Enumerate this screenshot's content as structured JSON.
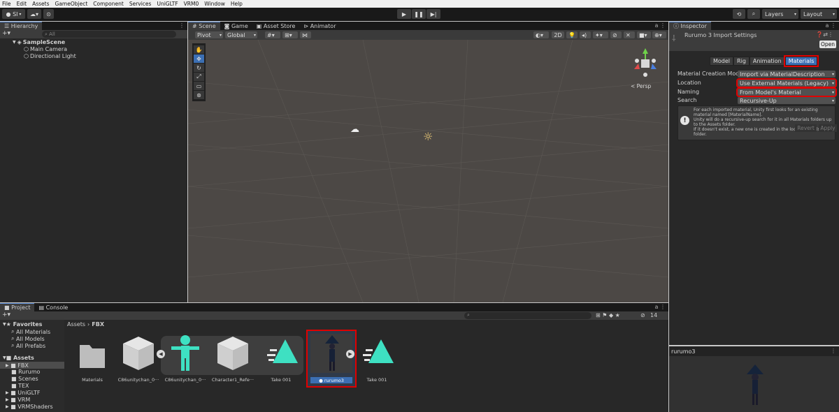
{
  "menu": [
    "File",
    "Edit",
    "Assets",
    "GameObject",
    "Component",
    "Services",
    "UniGLTF",
    "VRM0",
    "Window",
    "Help"
  ],
  "toolbar": {
    "account": "SI",
    "layers": "Layers",
    "layout": "Layout"
  },
  "hierarchy": {
    "tab": "Hierarchy",
    "search_placeholder": "All",
    "scene": "SampleScene",
    "items": [
      "Main Camera",
      "Directional Light"
    ]
  },
  "scene": {
    "tabs": [
      "Scene",
      "Game",
      "Asset Store",
      "Animator"
    ],
    "pivot": "Pivot",
    "global": "Global",
    "mode2d": "2D",
    "persp": "< Persp"
  },
  "inspector": {
    "tab": "Inspector",
    "title": "Rurumo 3 Import Settings",
    "open": "Open",
    "tabs": [
      "Model",
      "Rig",
      "Animation",
      "Materials"
    ],
    "fields": [
      {
        "label": "Material Creation Mode",
        "value": "Import via MaterialDescription"
      },
      {
        "label": "Location",
        "value": "Use External Materials (Legacy)"
      },
      {
        "label": "Naming",
        "value": "From Model's Material"
      },
      {
        "label": "Search",
        "value": "Recursive-Up"
      }
    ],
    "info": "For each imported material, Unity first looks for an existing material named [MaterialName].\nUnity will do a recursive-up search for it in all Materials folders up to the Assets folder.\nIf it doesn't exist, a new one is created in the local Materials folder.",
    "revert": "Revert",
    "apply": "Apply",
    "preview_title": "rurumo3"
  },
  "project": {
    "tabs": [
      "Project",
      "Console"
    ],
    "breadcrumb": [
      "Assets",
      "FBX"
    ],
    "count": "14",
    "favorites": "Favorites",
    "fav_items": [
      "All Materials",
      "All Models",
      "All Prefabs"
    ],
    "assets_root": "Assets",
    "tree": [
      "FBX",
      "Rurumo",
      "Scenes",
      "TEX",
      "UniGLTF",
      "VRM",
      "VRMShaders"
    ],
    "grid": [
      "Materials",
      "C86unitychan_0···",
      "C86unitychan_0···",
      "Character1_Refe···",
      "Take 001",
      "rurumo3",
      "Take 001"
    ]
  },
  "colors": {
    "accent": "#3c6fb3",
    "highlight": "#e00000",
    "teal": "#3ee0c2",
    "folder": "#bdbdbd"
  }
}
